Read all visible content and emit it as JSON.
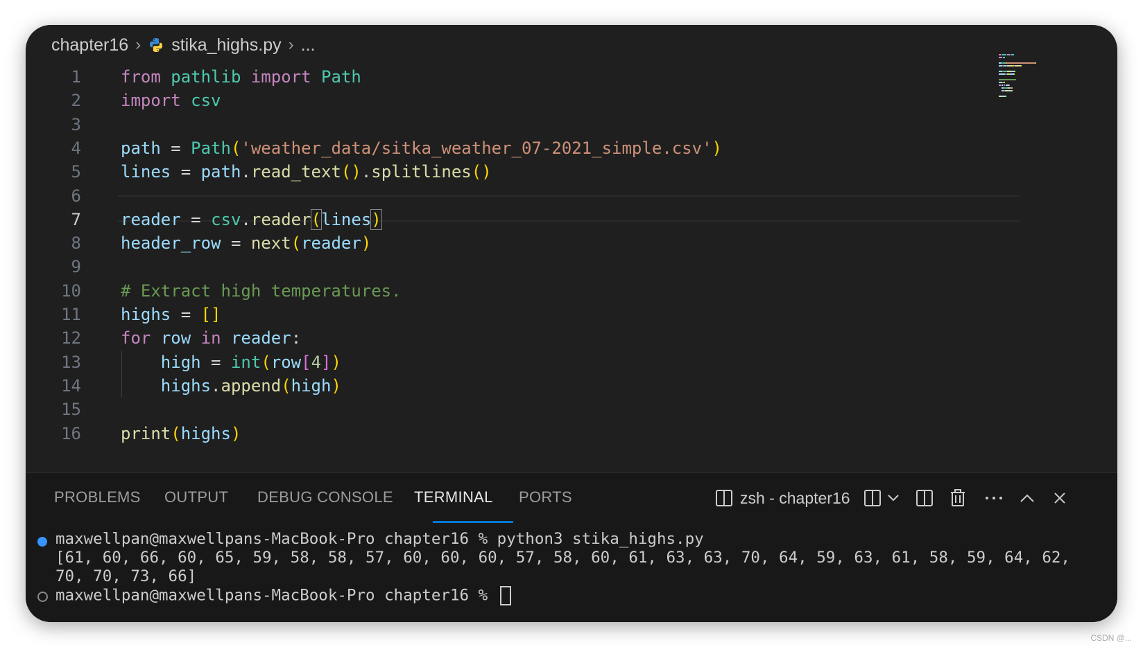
{
  "breadcrumb": {
    "folder": "chapter16",
    "file": "stika_highs.py",
    "more": "..."
  },
  "editor": {
    "active_line": 7,
    "lines": [
      {
        "n": "1",
        "tokens": [
          [
            "from",
            "kw"
          ],
          [
            " ",
            "op"
          ],
          [
            "pathlib",
            "ty"
          ],
          [
            " ",
            "op"
          ],
          [
            "import",
            "kw"
          ],
          [
            " ",
            "op"
          ],
          [
            "Path",
            "ty"
          ]
        ]
      },
      {
        "n": "2",
        "tokens": [
          [
            "import",
            "kw"
          ],
          [
            " ",
            "op"
          ],
          [
            "csv",
            "ty"
          ]
        ]
      },
      {
        "n": "3",
        "tokens": []
      },
      {
        "n": "4",
        "tokens": [
          [
            "path",
            "var"
          ],
          [
            " = ",
            "op"
          ],
          [
            "Path",
            "ty"
          ],
          [
            "(",
            "b1"
          ],
          [
            "'weather_data/sitka_weather_07-2021_simple.csv'",
            "str"
          ],
          [
            ")",
            "b1"
          ]
        ]
      },
      {
        "n": "5",
        "tokens": [
          [
            "lines",
            "var"
          ],
          [
            " = ",
            "op"
          ],
          [
            "path",
            "var"
          ],
          [
            ".",
            "op"
          ],
          [
            "read_text",
            "fn"
          ],
          [
            "()",
            "b1"
          ],
          [
            ".",
            "op"
          ],
          [
            "splitlines",
            "fn"
          ],
          [
            "()",
            "b1"
          ]
        ]
      },
      {
        "n": "6",
        "tokens": []
      },
      {
        "n": "7",
        "tokens": [
          [
            "reader",
            "var"
          ],
          [
            " = ",
            "op"
          ],
          [
            "csv",
            "ty"
          ],
          [
            ".",
            "op"
          ],
          [
            "reader",
            "fn"
          ],
          [
            "(",
            "b1 bm"
          ],
          [
            "lines",
            "var"
          ],
          [
            ")",
            "b1 bm"
          ]
        ]
      },
      {
        "n": "8",
        "tokens": [
          [
            "header_row",
            "var"
          ],
          [
            " = ",
            "op"
          ],
          [
            "next",
            "fn"
          ],
          [
            "(",
            "b1"
          ],
          [
            "reader",
            "var"
          ],
          [
            ")",
            "b1"
          ]
        ]
      },
      {
        "n": "9",
        "tokens": []
      },
      {
        "n": "10",
        "tokens": [
          [
            "# Extract high temperatures.",
            "cm"
          ]
        ]
      },
      {
        "n": "11",
        "tokens": [
          [
            "highs",
            "var"
          ],
          [
            " = ",
            "op"
          ],
          [
            "[]",
            "b1"
          ]
        ]
      },
      {
        "n": "12",
        "tokens": [
          [
            "for",
            "kw"
          ],
          [
            " ",
            "op"
          ],
          [
            "row",
            "var"
          ],
          [
            " ",
            "op"
          ],
          [
            "in",
            "kw"
          ],
          [
            " ",
            "op"
          ],
          [
            "reader",
            "var"
          ],
          [
            ":",
            "op"
          ]
        ]
      },
      {
        "n": "13",
        "tokens": [
          [
            "    ",
            "op"
          ],
          [
            "high",
            "var"
          ],
          [
            " = ",
            "op"
          ],
          [
            "int",
            "ty"
          ],
          [
            "(",
            "b1"
          ],
          [
            "row",
            "var"
          ],
          [
            "[",
            "b2"
          ],
          [
            "4",
            "num"
          ],
          [
            "]",
            "b2"
          ],
          [
            ")",
            "b1"
          ]
        ]
      },
      {
        "n": "14",
        "tokens": [
          [
            "    ",
            "op"
          ],
          [
            "highs",
            "var"
          ],
          [
            ".",
            "op"
          ],
          [
            "append",
            "fn"
          ],
          [
            "(",
            "b1"
          ],
          [
            "high",
            "var"
          ],
          [
            ")",
            "b1"
          ]
        ]
      },
      {
        "n": "15",
        "tokens": []
      },
      {
        "n": "16",
        "tokens": [
          [
            "print",
            "fn"
          ],
          [
            "(",
            "b1"
          ],
          [
            "highs",
            "var"
          ],
          [
            ")",
            "b1"
          ]
        ]
      }
    ]
  },
  "panel": {
    "tabs": [
      {
        "label": "PROBLEMS",
        "active": false
      },
      {
        "label": "OUTPUT",
        "active": false
      },
      {
        "label": "DEBUG CONSOLE",
        "active": false
      },
      {
        "label": "TERMINAL",
        "active": true
      },
      {
        "label": "PORTS",
        "active": false
      }
    ],
    "terminal_name": "zsh - chapter16",
    "toolbar_icons": [
      "terminal-icon",
      "split-terminal-icon",
      "chevron-down-icon",
      "split-editor-icon",
      "trash-icon",
      "more-icon",
      "maximize-chevron-up-icon",
      "close-icon"
    ]
  },
  "terminal": {
    "prompt": "maxwellpan@maxwellpans-MacBook-Pro chapter16 % ",
    "command": "python3 stika_highs.py",
    "output_line1": "[61, 60, 66, 60, 65, 59, 58, 58, 57, 60, 60, 60, 57, 58, 60, 61, 63, 63, 70, 64, 59, 63, 61, 58, 59, 64, 62,",
    "output_line2": "70, 70, 73, 66]",
    "prompt2": "maxwellpan@maxwellpans-MacBook-Pro chapter16 % "
  },
  "colors": {
    "keyword": "#c586c0",
    "type": "#4ec9b0",
    "function": "#dcdcaa",
    "string": "#ce9178",
    "variable": "#9cdcfe",
    "comment": "#6a9955",
    "bracket": "#ffd700",
    "accent": "#0078d4"
  },
  "watermark": "CSDN @..."
}
